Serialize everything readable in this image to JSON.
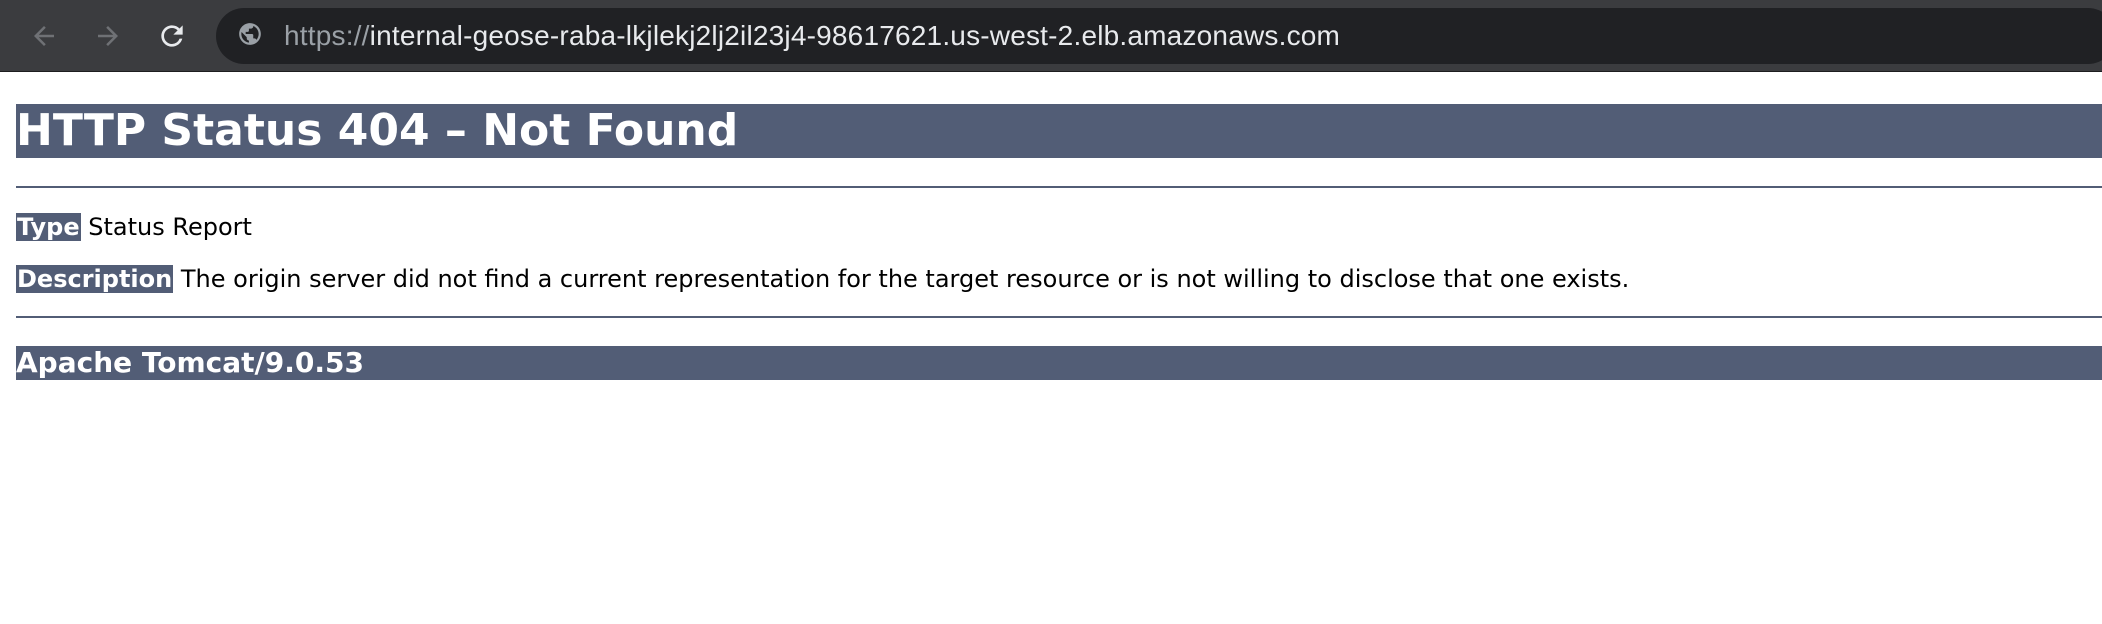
{
  "browser": {
    "url_scheme": "https://",
    "url_host": "internal-geose-raba-lkjlekj2lj2il23j4-98617621.us-west-2.elb.amazonaws.com",
    "back_icon": "arrow-left-icon",
    "forward_icon": "arrow-right-icon",
    "reload_icon": "reload-icon",
    "site_info_icon": "globe-icon"
  },
  "page": {
    "title": "HTTP Status 404 – Not Found",
    "type_label": "Type",
    "type_value": "Status Report",
    "description_label": "Description",
    "description_value": "The origin server did not find a current representation for the target resource or is not willing to disclose that one exists.",
    "server": "Apache Tomcat/9.0.53"
  },
  "colors": {
    "toolbar": "#3b3c3f",
    "omnibox": "#202124",
    "tomcat_accent": "#525d76"
  }
}
